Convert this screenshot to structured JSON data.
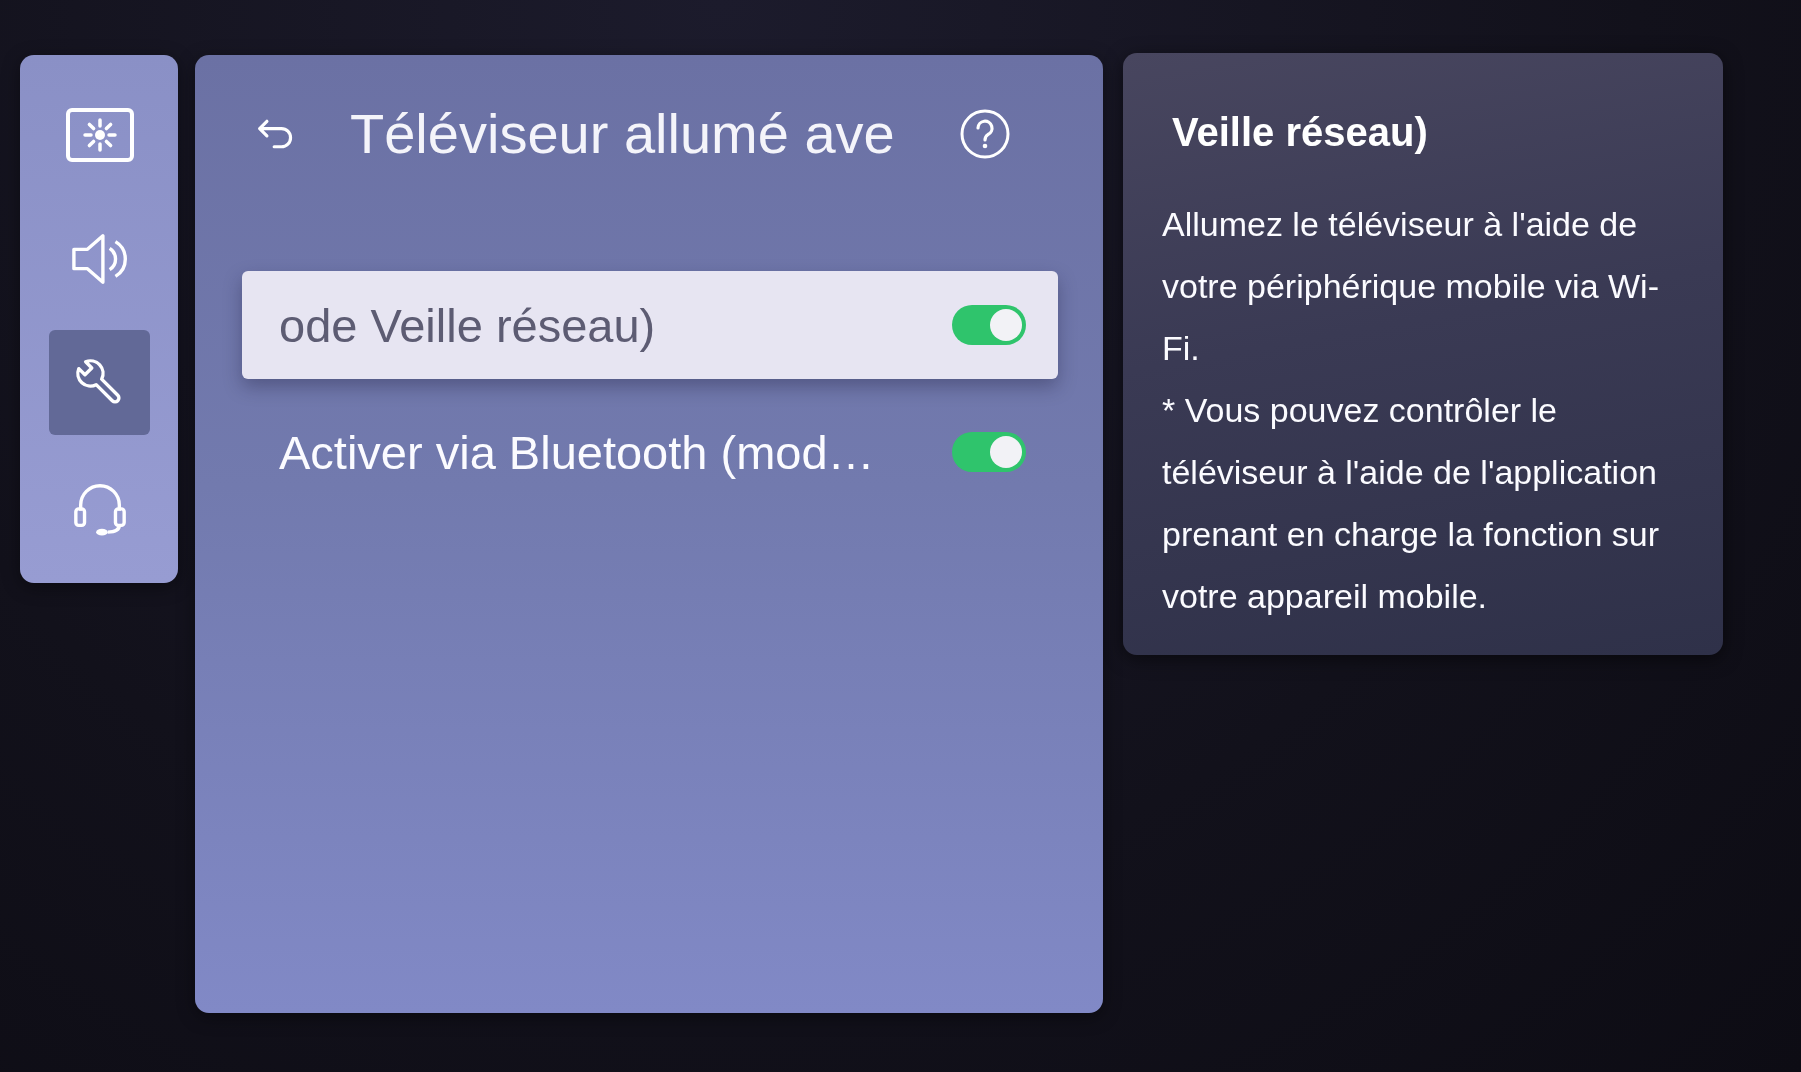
{
  "sidebar": {
    "items": [
      {
        "kind": "picture",
        "selected": false
      },
      {
        "kind": "sound",
        "selected": false
      },
      {
        "kind": "general",
        "selected": true
      },
      {
        "kind": "support",
        "selected": false
      }
    ]
  },
  "panel": {
    "title": "Téléviseur allumé ave",
    "options": [
      {
        "label": "ode Veille réseau)",
        "selected": true,
        "on": true
      },
      {
        "label": "Activer via Bluetooth (mod…",
        "selected": false,
        "on": true
      }
    ]
  },
  "help": {
    "title": "Veille réseau)",
    "paragraphs": [
      "Allumez le téléviseur à l'aide de votre périphérique mobile via Wi-Fi.",
      "* Vous pouvez contrôler le téléviseur à l'aide de l'application prenant en charge la fonction sur votre appareil mobile."
    ]
  }
}
